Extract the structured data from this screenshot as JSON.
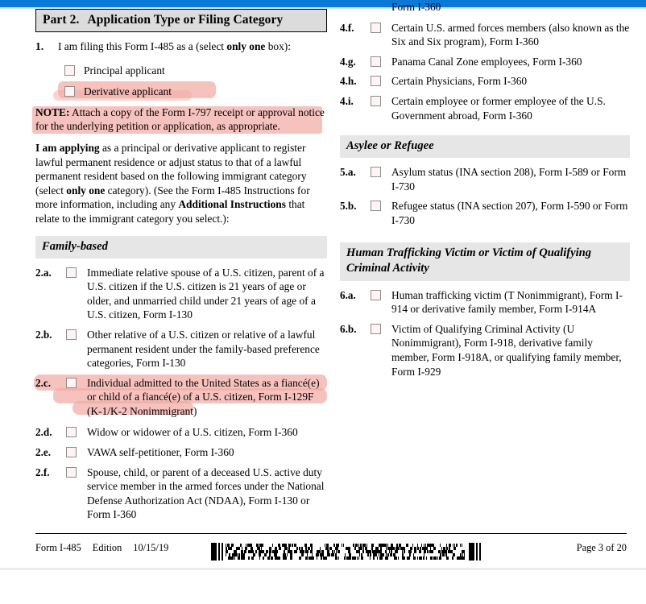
{
  "window": {
    "chrome_color": "#0b7ad6"
  },
  "document": {
    "form_number": "Form I-485",
    "page_label": "Page 3 of 20"
  },
  "part_header": {
    "part_number": "Part 2.",
    "title": "Application Type or Filing Category"
  },
  "question_1": {
    "number": "1.",
    "text_before": "I am filing this Form I-485 as a (select ",
    "emphasis": "only one",
    "text_after": " box):",
    "options": [
      {
        "id": "principal-applicant",
        "label": "Principal applicant",
        "highlighted": false
      },
      {
        "id": "derivative-applicant",
        "label": "Derivative applicant",
        "highlighted": true
      }
    ]
  },
  "note": {
    "label": "NOTE:",
    "text": " Attach a copy of the Form I-797 receipt or approval notice for the underlying petition or application, as appropriate.",
    "highlighted": true
  },
  "applying_paragraph": {
    "lead_bold": "I am applying",
    "part1": " as a principal or derivative applicant to register lawful permanent residence or adjust status to that of a lawful permanent resident based on the following immigrant category (select ",
    "bold1": "only one",
    "part2": " category).  (See the Form I-485 Instructions for more information, including any ",
    "bold2": "Additional Instructions",
    "part3": " that relate to the immigrant category you select.):"
  },
  "sections": [
    {
      "id": "family-based",
      "band_title": "Family-based",
      "column": "left",
      "items": [
        {
          "number": "2.a.",
          "text": "Immediate relative spouse of a U.S. citizen, parent of a U.S. citizen if the U.S. citizen is 21 years of age or older, and unmarried child under 21 years of age of a U.S. citizen, Form I-130",
          "highlighted": false
        },
        {
          "number": "2.b.",
          "text": "Other relative of a U.S. citizen or relative of a lawful permanent resident under the family-based preference categories, Form I-130",
          "highlighted": false
        },
        {
          "number": "2.c.",
          "text": "Individual admitted to the United States as a fiancé(e) or child of a fiancé(e) of a U.S. citizen, Form I-129F (K-1/K-2 Nonimmigrant)",
          "highlighted": true
        },
        {
          "number": "2.d.",
          "text": "Widow or widower of a U.S. citizen, Form I-360",
          "highlighted": false
        },
        {
          "number": "2.e.",
          "text": "VAWA self-petitioner, Form I-360",
          "highlighted": false
        },
        {
          "number": "2.f.",
          "text": "Spouse, child, or parent of a deceased U.S. active duty service member in the armed forces under the National Defense Authorization Act (NDAA), Form I-130 or Form I-360",
          "highlighted": false
        }
      ]
    },
    {
      "id": "special-immigrant-continued",
      "band_title": "",
      "column": "right",
      "continuation_line": "Form I-360",
      "items": [
        {
          "number": "4.f.",
          "text": "Certain U.S. armed forces members (also known as the Six and Six program), Form I-360",
          "highlighted": false
        },
        {
          "number": "4.g.",
          "text": "Panama Canal Zone employees, Form I-360",
          "highlighted": false
        },
        {
          "number": "4.h.",
          "text": "Certain Physicians, Form I-360",
          "highlighted": false
        },
        {
          "number": "4.i.",
          "text": "Certain employee or former employee of the U.S. Government abroad, Form I-360",
          "highlighted": false
        }
      ]
    },
    {
      "id": "asylee-or-refugee",
      "band_title": "Asylee or Refugee",
      "column": "right",
      "items": [
        {
          "number": "5.a.",
          "text": "Asylum status (INA section 208), Form I-589 or Form I-730",
          "highlighted": false
        },
        {
          "number": "5.b.",
          "text": "Refugee status (INA section 207), Form I-590 or Form I-730",
          "highlighted": false
        }
      ]
    },
    {
      "id": "human-trafficking",
      "band_title": "Human Trafficking Victim or Victim of Qualifying Criminal Activity",
      "column": "right",
      "items": [
        {
          "number": "6.a.",
          "text": "Human trafficking victim (T Nonimmigrant), Form I-914 or derivative family member, Form I-914A",
          "highlighted": false
        },
        {
          "number": "6.b.",
          "text": "Victim of Qualifying Criminal Activity (U Nonimmigrant), Form I-918, derivative family member, Form I-918A, or qualifying family member, Form I-929",
          "highlighted": false
        }
      ]
    }
  ],
  "footer": {
    "form": "Form I-485",
    "edition_label": "Edition",
    "edition_date": "10/15/19",
    "page": "Page 3 of 20",
    "barcode_type": "pdf417-2d-barcode"
  },
  "colors": {
    "highlighter": "#f2aba4",
    "band": "#e6e6e6",
    "part_header_fill": "#dcdcdc",
    "checkbox_border": "#8d8d8d"
  }
}
